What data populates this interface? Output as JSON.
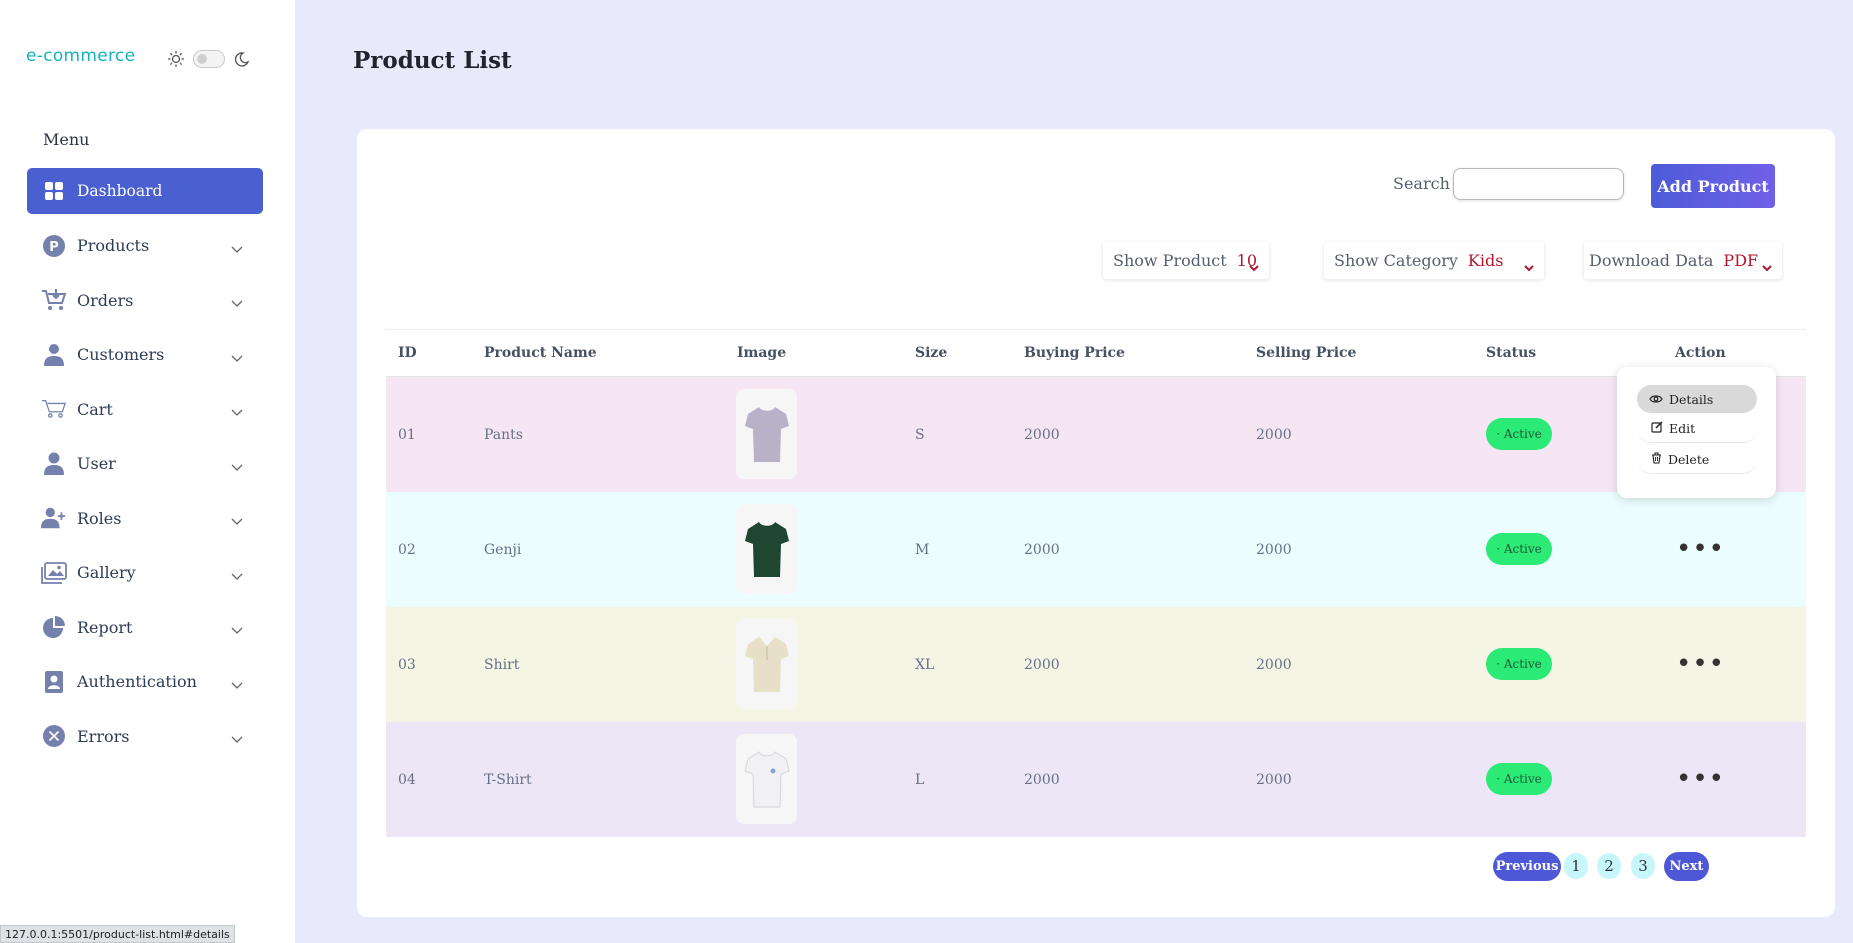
{
  "brand": {
    "logo": "e-commerce"
  },
  "sidebar": {
    "menu_title": "Menu",
    "items": [
      {
        "label": "Dashboard",
        "icon": "grid-icon",
        "active": true
      },
      {
        "label": "Products",
        "icon": "product-p-icon"
      },
      {
        "label": "Orders",
        "icon": "cart-download-icon"
      },
      {
        "label": "Customers",
        "icon": "customer-icon"
      },
      {
        "label": "Cart",
        "icon": "cart-icon"
      },
      {
        "label": "User",
        "icon": "user-icon"
      },
      {
        "label": "Roles",
        "icon": "user-plus-icon"
      },
      {
        "label": "Gallery",
        "icon": "gallery-icon"
      },
      {
        "label": "Report",
        "icon": "pie-chart-icon"
      },
      {
        "label": "Authentication",
        "icon": "id-badge-icon"
      },
      {
        "label": "Errors",
        "icon": "error-x-icon"
      }
    ]
  },
  "page": {
    "title": "Product List"
  },
  "toolbar": {
    "search_label": "Search",
    "search_value": "",
    "add_label": "Add Product"
  },
  "filters": [
    {
      "label": "Show Product",
      "value": "10"
    },
    {
      "label": "Show Category",
      "value": "Kids"
    },
    {
      "label": "Download Data",
      "value": "PDF"
    }
  ],
  "table": {
    "headers": [
      "ID",
      "Product Name",
      "Image",
      "Size",
      "Buying Price",
      "Selling Price",
      "Status",
      "Action"
    ],
    "rows": [
      {
        "id": "01",
        "name": "Pants",
        "size": "S",
        "buy": "2000",
        "sell": "2000",
        "status": "· Active",
        "bg": "#f6e6f4",
        "shirt": "#b9b1c8"
      },
      {
        "id": "02",
        "name": "Genji",
        "size": "M",
        "buy": "2000",
        "sell": "2000",
        "status": "· Active",
        "bg": "#ebfdfe",
        "shirt": "#1f4630"
      },
      {
        "id": "03",
        "name": "Shirt",
        "size": "XL",
        "buy": "2000",
        "sell": "2000",
        "status": "· Active",
        "bg": "#f5f5e6",
        "shirt": "#e8dfc8"
      },
      {
        "id": "04",
        "name": "T-Shirt",
        "size": "L",
        "buy": "2000",
        "sell": "2000",
        "status": "· Active",
        "bg": "#ede6f6",
        "shirt": "#f1f1f4"
      }
    ]
  },
  "action_menu": {
    "details": "Details",
    "edit": "Edit",
    "delete": "Delete"
  },
  "pagination": {
    "prev": "Previous",
    "pages": [
      "1",
      "2",
      "3"
    ],
    "next": "Next"
  },
  "status_bar": {
    "url": "127.0.0.1:5501/product-list.html#details"
  },
  "colors": {
    "primary": "#4a5fd0",
    "accent_teal": "#10b3bf",
    "active_badge": "#2bea76",
    "filter_value": "#b1172e"
  }
}
